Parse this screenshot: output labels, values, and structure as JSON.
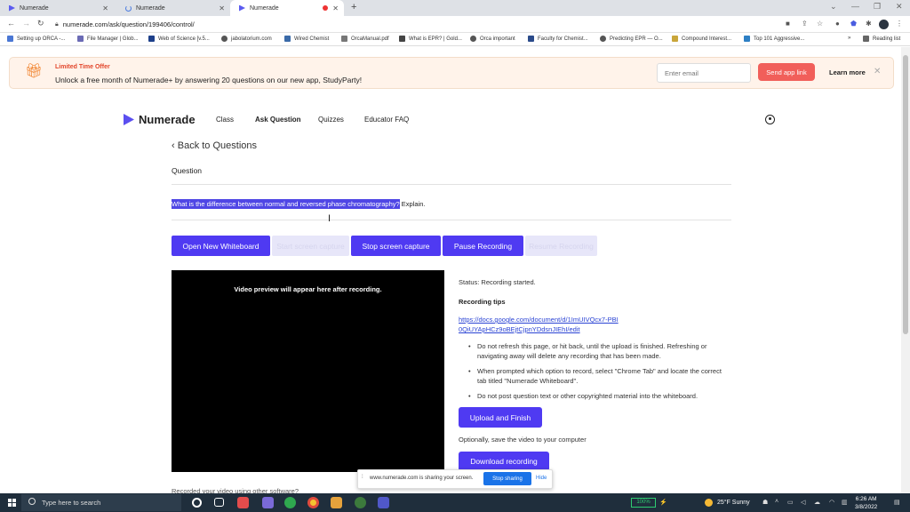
{
  "browser": {
    "tabs": [
      {
        "label": "Numerade",
        "state": "normal"
      },
      {
        "label": "Numerade",
        "state": "loading"
      },
      {
        "label": "Numerade",
        "state": "active-recording"
      }
    ],
    "url": "numerade.com/ask/question/199406/control/",
    "bookmarks": [
      "Setting up ORCA -...",
      "File Manager | Glob...",
      "Web of Science [v.5...",
      "jabolatorium.com",
      "Wired Chemist",
      "OrcaManual.pdf",
      "What is EPR? | Gold...",
      "Orca important",
      "Faculty for Chemist...",
      "Predicting EPR — O...",
      "Compound Interest...",
      "Top 101 Aggressive..."
    ],
    "reading_list": "Reading list"
  },
  "banner": {
    "title": "Limited Time Offer",
    "text": "Unlock a free month of Numerade+ by answering 20 questions on our new app, StudyParty!",
    "email_placeholder": "Enter email",
    "send_label": "Send app link",
    "learn_label": "Learn more",
    "close_glyph": "✕"
  },
  "nav": {
    "brand": "Numerade",
    "items": [
      "Class",
      "Ask Question",
      "Quizzes",
      "Educator FAQ"
    ]
  },
  "page": {
    "back_label": "Back to Questions",
    "question_label": "Question",
    "question_highlight": "What is the difference between normal and reversed phase chromatography?",
    "question_rest": " Explain.",
    "buttons": [
      {
        "label": "Open New Whiteboard",
        "enabled": true
      },
      {
        "label": "Start screen capture",
        "enabled": false
      },
      {
        "label": "Stop screen capture",
        "enabled": true
      },
      {
        "label": "Pause Recording",
        "enabled": true
      },
      {
        "label": "Resume Recording",
        "enabled": false
      }
    ],
    "video_text": "Video preview will appear here after recording.",
    "status": "Status: Recording started.",
    "tips_title": "Recording tips",
    "tips_link": "https://docs.google.com/document/d/1ImUIVQcx7-PBI0QiUYApHCz9oBEjtCjpnYDdsnJIEhI/edit",
    "tips": [
      "Do not refresh this page, or hit back, until the upload is finished. Refreshing or navigating away will delete any recording that has been made.",
      "When prompted which option to record, select \"Chrome Tab\" and locate the correct tab titled \"Numerade Whiteboard\".",
      "Do not post question text or other copyrighted material into the whiteboard."
    ],
    "upload_label": "Upload and Finish",
    "optional_text": "Optionally, save the video to your computer",
    "download_label": "Download recording",
    "recorded_text": "Recorded your video using other software?"
  },
  "sharing": {
    "text": "www.numerade.com is sharing your screen.",
    "stop_label": "Stop sharing",
    "hide_label": "Hide"
  },
  "taskbar": {
    "search_placeholder": "Type here to search",
    "battery": "100%",
    "weather": "25°F  Sunny",
    "time": "6:26 AM",
    "date": "3/8/2022"
  },
  "colors": {
    "accent": "#4f3af2",
    "banner_bg": "#fff3ea",
    "send_button": "#f15f5a",
    "highlight": "#4f46e5"
  }
}
